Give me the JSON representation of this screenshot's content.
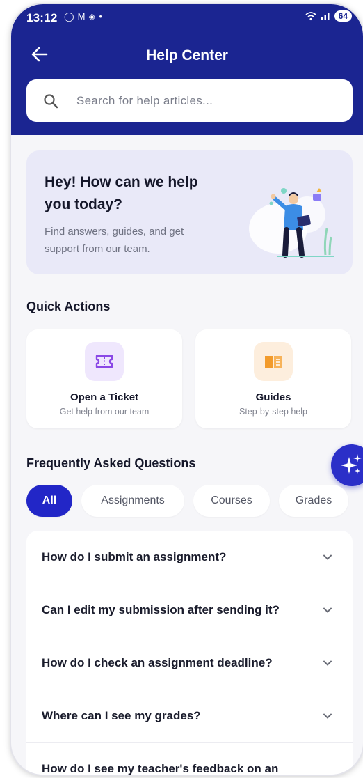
{
  "status_bar": {
    "time": "13:12",
    "battery": "64"
  },
  "header": {
    "title": "Help Center"
  },
  "search": {
    "placeholder": "Search for help articles..."
  },
  "hero": {
    "title": "Hey! How can we help you today?",
    "subtitle": "Find answers, guides, and get support from our team."
  },
  "quick_actions": {
    "title": "Quick Actions",
    "items": [
      {
        "label": "Open a Ticket",
        "sublabel": "Get help from our team",
        "icon": "ticket-icon",
        "color": "#efe7fd"
      },
      {
        "label": "Guides",
        "sublabel": "Step-by-step help",
        "icon": "book-icon",
        "color": "#fdeedd"
      }
    ]
  },
  "faq": {
    "title": "Frequently Asked Questions",
    "filters": [
      {
        "label": "All",
        "active": true
      },
      {
        "label": "Assignments",
        "active": false
      },
      {
        "label": "Courses",
        "active": false
      },
      {
        "label": "Grades",
        "active": false
      }
    ],
    "questions": [
      "How do I submit an assignment?",
      "Can I edit my submission after sending it?",
      "How do I check an assignment deadline?",
      "Where can I see my grades?",
      "How do I see my teacher's feedback on an"
    ]
  },
  "colors": {
    "header": "#1b2591",
    "accent": "#2226c7",
    "background": "#f6f6f9"
  }
}
